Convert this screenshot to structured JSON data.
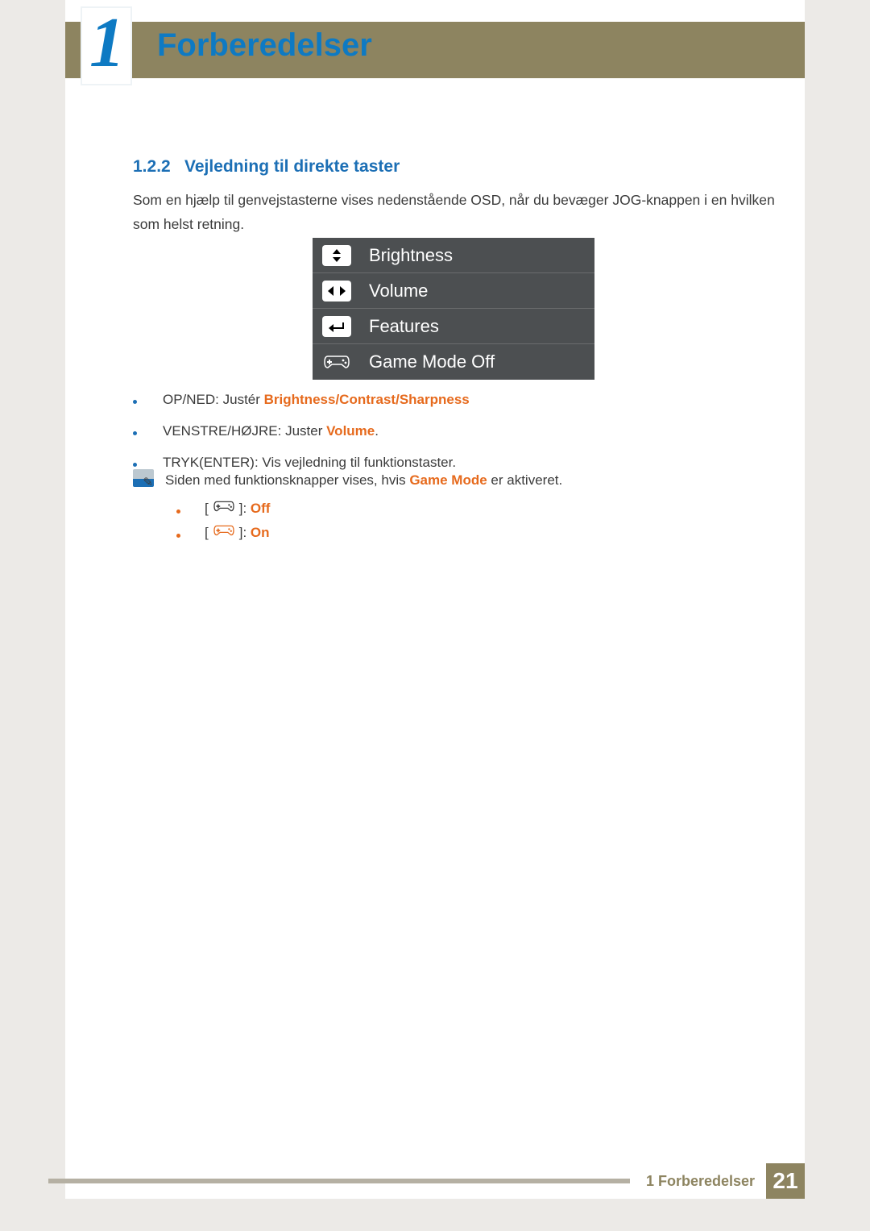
{
  "header": {
    "chapter_number": "1",
    "chapter_title": "Forberedelser"
  },
  "section": {
    "number": "1.2.2",
    "title": "Vejledning til direkte taster",
    "intro": "Som en hjælp til genvejstasterne vises nedenstående OSD, når du bevæger JOG-knappen i en hvilken som helst retning."
  },
  "osd": {
    "rows": [
      {
        "icon": "up-down-icon",
        "label": "Brightness"
      },
      {
        "icon": "left-right-icon",
        "label": "Volume"
      },
      {
        "icon": "enter-icon",
        "label": "Features"
      },
      {
        "icon": "gamepad-icon",
        "label": "Game Mode Off",
        "plain": true
      }
    ]
  },
  "bullets": [
    {
      "prefix": "OP/NED: Justér ",
      "red": "Brightness",
      "sep1": "/",
      "red2": "Contrast",
      "sep2": "/",
      "red3": "Sharpness"
    },
    {
      "prefix": "VENSTRE/HØJRE: Juster ",
      "red": "Volume",
      "suffix": "."
    },
    {
      "prefix": "TRYK(ENTER): Vis vejledning til funktionstaster."
    }
  ],
  "note": {
    "text_pre": "Siden med funktionsknapper vises, hvis ",
    "text_red": "Game Mode",
    "text_post": " er aktiveret.",
    "items": [
      {
        "icon_color": "#3b3b3b",
        "state": "Off"
      },
      {
        "icon_color": "#e66a1d",
        "state": "On"
      }
    ]
  },
  "footer": {
    "text": "1 Forberedelser",
    "page": "21"
  }
}
